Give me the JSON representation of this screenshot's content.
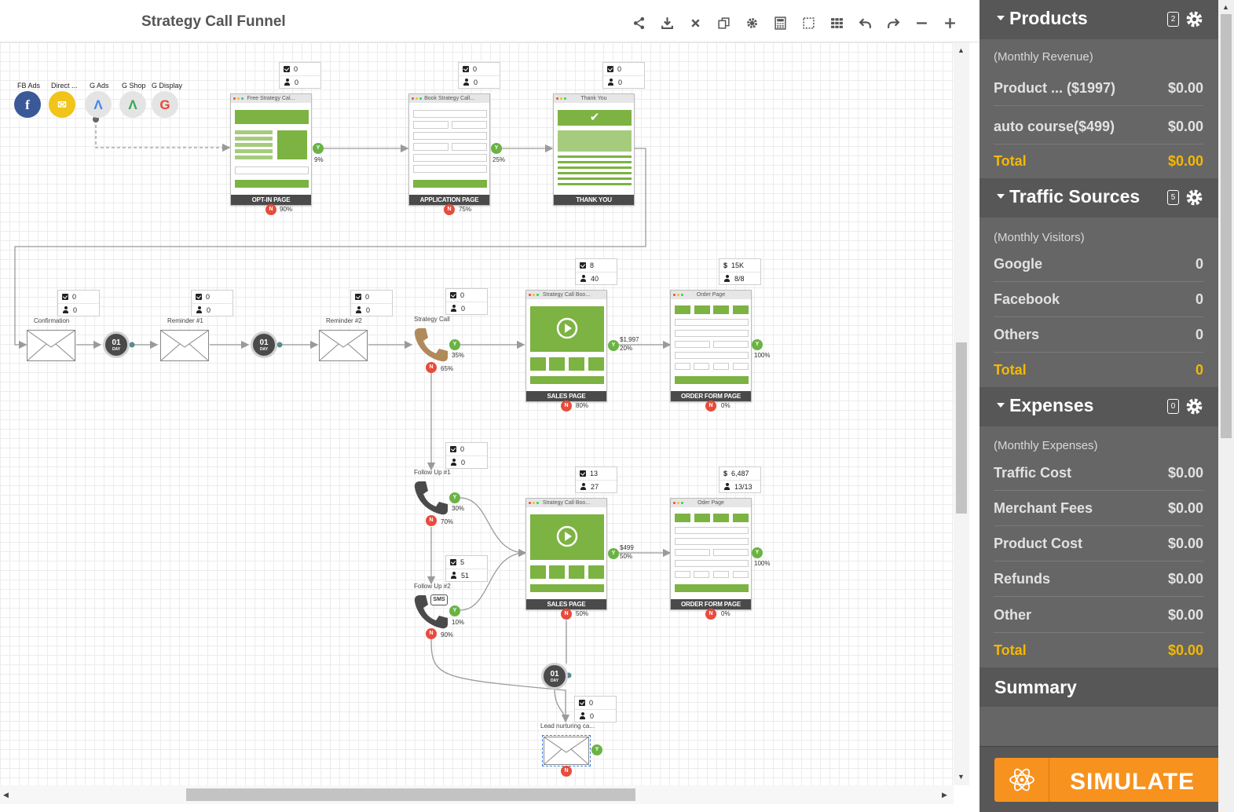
{
  "funnel": {
    "title": "Strategy Call Funnel"
  },
  "toolbar": [
    "share-icon",
    "download-icon",
    "close-icon",
    "copy-icon",
    "gear-icon",
    "calculator-icon",
    "select-icon",
    "grid-icon",
    "undo-icon",
    "redo-icon",
    "zoom-out-icon",
    "zoom-in-icon"
  ],
  "traffic_sources": [
    {
      "label": "FB Ads",
      "icon": "facebook-icon"
    },
    {
      "label": "Direct ...",
      "icon": "direct-mail-icon"
    },
    {
      "label": "G Ads",
      "icon": "google-ads-icon"
    },
    {
      "label": "G Shop",
      "icon": "google-shopping-icon"
    },
    {
      "label": "G Display",
      "icon": "google-display-icon"
    }
  ],
  "pages": {
    "optin": {
      "header": "Free Strategy Cal...",
      "footer": "OPT-IN PAGE",
      "count": "0",
      "people": "0",
      "yes": "9%",
      "no": "90%"
    },
    "application": {
      "header": "Book Strategy Call...",
      "footer": "APPLICATION PAGE",
      "count": "0",
      "people": "0",
      "yes": "25%",
      "no": "75%"
    },
    "thankyou": {
      "header": "Thank You",
      "footer": "THANK YOU",
      "count": "0",
      "people": "0"
    },
    "sales1": {
      "header": "Strategy Call Boo...",
      "footer": "SALES PAGE",
      "count": "8",
      "people": "40",
      "price": "$1,997",
      "yes": "20%",
      "no": "80%"
    },
    "order1": {
      "header": "Order Page",
      "footer": "ORDER FORM PAGE",
      "cash": "15K",
      "people": "8/8",
      "yes": "100%",
      "no": "0%"
    },
    "sales2": {
      "header": "Strategy Call Boo...",
      "footer": "SALES PAGE",
      "count": "13",
      "people": "27",
      "price": "$499",
      "yes": "50%",
      "no": "50%"
    },
    "order2": {
      "header": "Oder Page",
      "footer": "ORDER FORM PAGE",
      "cash": "6,487",
      "people": "13/13",
      "yes": "100%",
      "no": "0%"
    }
  },
  "emails": {
    "confirmation": {
      "label": "Confirmation",
      "count": "0",
      "people": "0"
    },
    "reminder1": {
      "label": "Reminder #1",
      "count": "0",
      "people": "0"
    },
    "reminder2": {
      "label": "Reminder #2",
      "count": "0",
      "people": "0"
    },
    "nurturing": {
      "label": "Lead nurturing ca...",
      "count": "0",
      "people": "0"
    }
  },
  "calls": {
    "strategy": {
      "label": "Strategy Call",
      "count": "0",
      "people": "0",
      "yes": "35%",
      "no": "65%"
    },
    "followup1": {
      "label": "Follow Up #1",
      "count": "0",
      "people": "0",
      "yes": "30%",
      "no": "70%"
    },
    "followup2": {
      "label": "Follow Up #2",
      "count": "5",
      "people": "51",
      "yes": "10%",
      "no": "90%",
      "badge": "SMS"
    }
  },
  "timer": {
    "value": "01",
    "unit": "DAY"
  },
  "yes_letter": "Y",
  "no_letter": "N",
  "cash_symbol": "$",
  "sidebar": {
    "products": {
      "title": "Products",
      "badge": "2",
      "subtitle": "(Monthly Revenue)",
      "rows": [
        {
          "label": "Product ... ($1997)",
          "value": "$0.00"
        },
        {
          "label": "auto course($499)",
          "value": "$0.00"
        }
      ],
      "total_label": "Total",
      "total_value": "$0.00"
    },
    "traffic": {
      "title": "Traffic Sources",
      "badge": "5",
      "subtitle": "(Monthly Visitors)",
      "rows": [
        {
          "label": "Google",
          "value": "0"
        },
        {
          "label": "Facebook",
          "value": "0"
        },
        {
          "label": "Others",
          "value": "0"
        }
      ],
      "total_label": "Total",
      "total_value": "0"
    },
    "expenses": {
      "title": "Expenses",
      "badge": "0",
      "subtitle": "(Monthly Expenses)",
      "rows": [
        {
          "label": "Traffic Cost",
          "value": "$0.00"
        },
        {
          "label": "Merchant Fees",
          "value": "$0.00"
        },
        {
          "label": "Product Cost",
          "value": "$0.00"
        },
        {
          "label": "Refunds",
          "value": "$0.00"
        },
        {
          "label": "Other",
          "value": "$0.00"
        }
      ],
      "total_label": "Total",
      "total_value": "$0.00"
    },
    "summary": "Summary",
    "simulate": "SIMULATE"
  },
  "colors": {
    "accent": "#7cb342",
    "no": "#e74c3c",
    "total": "#f5b800",
    "simulate": "#f7921e",
    "sidebar_bg": "#666666"
  }
}
